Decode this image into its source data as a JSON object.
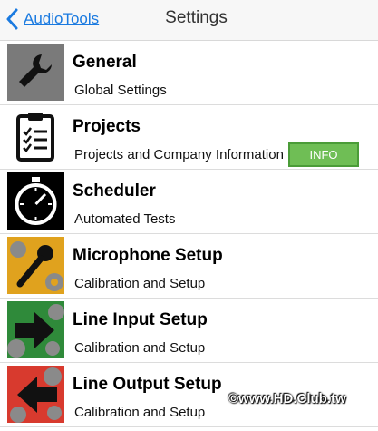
{
  "nav": {
    "back_label": "AudioTools",
    "title": "Settings"
  },
  "items": [
    {
      "title": "General",
      "subtitle": "Global Settings",
      "icon": "wrench-icon"
    },
    {
      "title": "Projects",
      "subtitle": "Projects and Company Information",
      "icon": "clipboard-checklist-icon"
    },
    {
      "title": "Scheduler",
      "subtitle": "Automated Tests",
      "icon": "stopwatch-icon"
    },
    {
      "title": "Microphone Setup",
      "subtitle": "Calibration and Setup",
      "icon": "microphone-gears-icon"
    },
    {
      "title": "Line Input Setup",
      "subtitle": "Calibration and Setup",
      "icon": "line-input-arrow-icon"
    },
    {
      "title": "Line Output Setup",
      "subtitle": "Calibration and Setup",
      "icon": "line-output-arrow-icon"
    }
  ],
  "info_button": {
    "label": "INFO",
    "color": "#6fbe55"
  },
  "watermark": "©www.HD.Club.tw",
  "colors": {
    "link": "#1a7ae0",
    "general_bg": "#7a7a7a",
    "mic_bg": "#e0a21e",
    "line_in_bg": "#2f8a3a",
    "line_out_bg": "#d83a2e"
  }
}
